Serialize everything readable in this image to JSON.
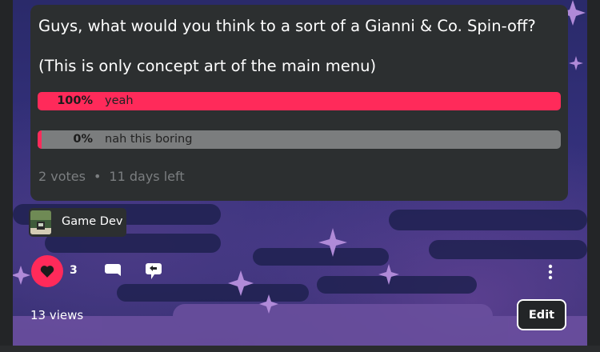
{
  "poll": {
    "question": "Guys, what would you think to a sort of a Gianni & Co. Spin-off?",
    "subtitle": "(This is only concept art of the main menu)",
    "options": [
      {
        "percent": "100%",
        "label": "yeah",
        "share": 1.0
      },
      {
        "percent": "0%",
        "label": "nah this boring",
        "share": 0.0
      }
    ],
    "votes": "2 votes",
    "separator": "•",
    "time_left": "11 days left"
  },
  "category": {
    "label": "Game Dev"
  },
  "actions": {
    "like_count": "3"
  },
  "footer": {
    "views": "13 views",
    "edit_label": "Edit"
  },
  "colors": {
    "accent": "#ff2a5a",
    "card": "#2c2f30",
    "bar_empty": "#7b7d7e",
    "background": "#232527"
  },
  "icons": {
    "like": "heart-icon",
    "comment": "comment-bubble-icon",
    "share": "repost-icon",
    "more": "vertical-ellipsis-icon"
  }
}
